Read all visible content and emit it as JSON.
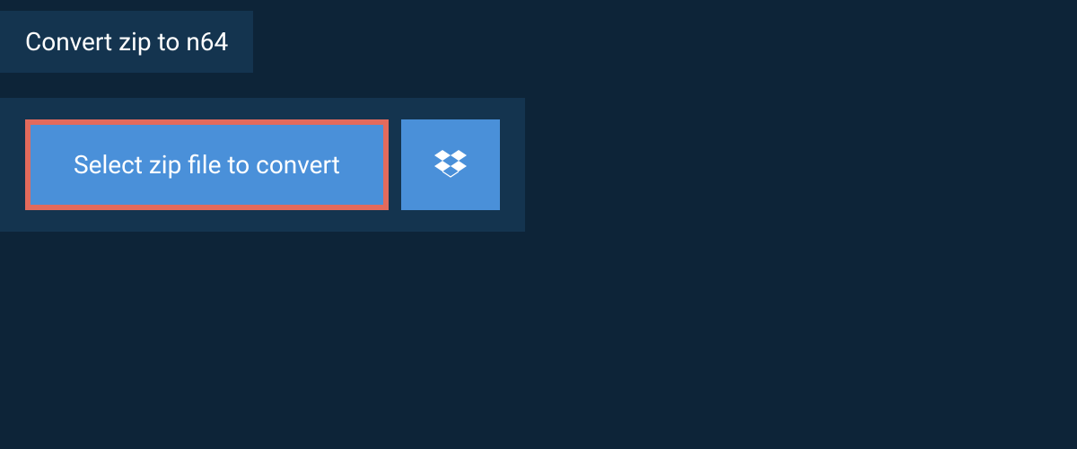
{
  "header": {
    "title": "Convert zip to n64"
  },
  "main": {
    "select_button_label": "Select zip file to convert"
  },
  "colors": {
    "background": "#0d2438",
    "panel": "#14344f",
    "button": "#4a90d9",
    "highlight_border": "#e36a5c",
    "text": "#ffffff"
  }
}
